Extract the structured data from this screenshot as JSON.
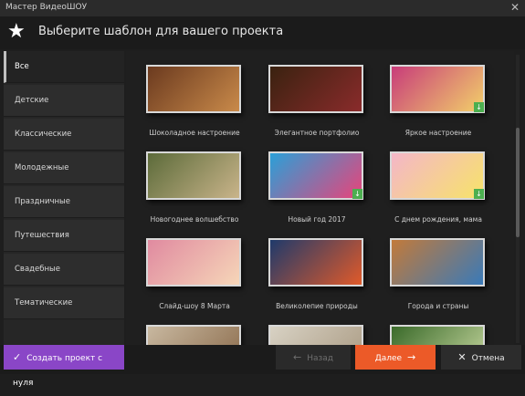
{
  "window": {
    "title": "Мастер ВидеоШОУ",
    "close_glyph": "✕"
  },
  "header": {
    "title": "Выберите шаблон для вашего проекта",
    "icon": "star-icon",
    "icon_glyph": "★"
  },
  "sidebar": {
    "items": [
      {
        "label": "Все",
        "active": true
      },
      {
        "label": "Детские"
      },
      {
        "label": "Классические"
      },
      {
        "label": "Молодежные"
      },
      {
        "label": "Праздничные"
      },
      {
        "label": "Путешествия"
      },
      {
        "label": "Свадебные"
      },
      {
        "label": "Тематические"
      }
    ]
  },
  "templates": [
    {
      "name": "Шоколадное настроение",
      "colors": [
        "#6b3a1f",
        "#c98a4a"
      ],
      "download": false
    },
    {
      "name": "Элегантное портфолио",
      "colors": [
        "#3a2210",
        "#8a2b2b"
      ],
      "download": false
    },
    {
      "name": "Яркое настроение",
      "colors": [
        "#c83c7a",
        "#f2d06a"
      ],
      "download": true
    },
    {
      "name": "Новогоднее волшебство",
      "colors": [
        "#5c6b3a",
        "#c9b48a"
      ],
      "download": false
    },
    {
      "name": "Новый год 2017",
      "colors": [
        "#2aa0d8",
        "#e8447a"
      ],
      "download": true
    },
    {
      "name": "С днем рождения, мама",
      "colors": [
        "#f4b6c8",
        "#f7e36a"
      ],
      "download": true
    },
    {
      "name": "Слайд-шоу 8 Марта",
      "colors": [
        "#e08aa0",
        "#f6d6b8"
      ],
      "download": false
    },
    {
      "name": "Великолепие природы",
      "colors": [
        "#1f3a6b",
        "#e05a2a"
      ],
      "download": false
    },
    {
      "name": "Города и страны",
      "colors": [
        "#c27a3a",
        "#3a7ab8"
      ],
      "download": false
    },
    {
      "name": "",
      "colors": [
        "#c8b8a0",
        "#8a6a4a"
      ],
      "download": false
    },
    {
      "name": "",
      "colors": [
        "#d8d2c4",
        "#a89880"
      ],
      "download": false
    },
    {
      "name": "",
      "colors": [
        "#3a6a2a",
        "#c8d8a0"
      ],
      "download": false
    }
  ],
  "footer": {
    "create_label": "Создать проект с нуля",
    "create_icon": "check-icon",
    "back_label": "Назад",
    "next_label": "Далее",
    "cancel_label": "Отмена"
  },
  "colors": {
    "accent_create": "#8a46c7",
    "accent_next": "#ec5a28",
    "download_badge": "#4caf50"
  }
}
